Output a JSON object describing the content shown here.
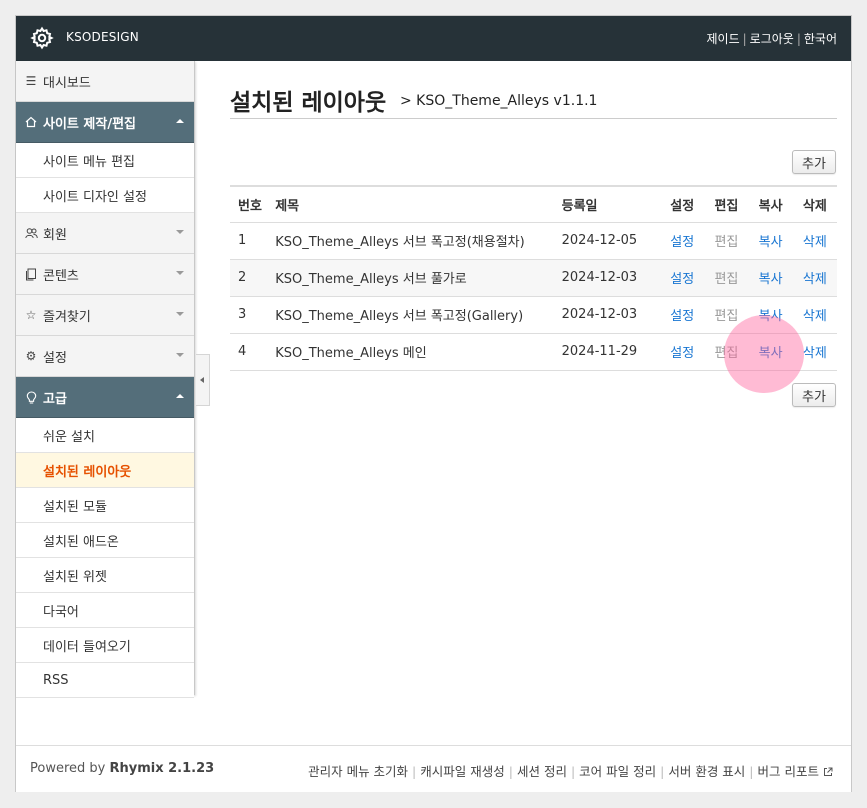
{
  "header": {
    "brand": "KSODESIGN",
    "links": [
      "제이드",
      "로그아웃",
      "한국어"
    ]
  },
  "sidebar": {
    "dashboard": "대시보드",
    "site_section": {
      "label": "사이트 제작/편집",
      "items": [
        "사이트 메뉴 편집",
        "사이트 디자인 설정"
      ]
    },
    "members": "회원",
    "contents": "콘텐츠",
    "favorites": "즐겨찾기",
    "settings": "설정",
    "advanced_section": {
      "label": "고급",
      "items": [
        "쉬운 설치",
        "설치된 레이아웃",
        "설치된 모듈",
        "설치된 애드온",
        "설치된 위젯",
        "다국어",
        "데이터 들여오기",
        "RSS"
      ],
      "active_index": 1
    }
  },
  "main": {
    "title": "설치된 레이아웃",
    "subtitle": "> KSO_Theme_Alleys v1.1.1",
    "add_button": "추가",
    "table": {
      "headers": [
        "번호",
        "제목",
        "등록일",
        "설정",
        "편집",
        "복사",
        "삭제"
      ],
      "rows": [
        {
          "no": "1",
          "title": "KSO_Theme_Alleys 서브 폭고정(채용절차)",
          "date": "2024-12-05",
          "settings": "설정",
          "edit": "편집",
          "copy": "복사",
          "delete": "삭제"
        },
        {
          "no": "2",
          "title": "KSO_Theme_Alleys 서브 풀가로",
          "date": "2024-12-03",
          "settings": "설정",
          "edit": "편집",
          "copy": "복사",
          "delete": "삭제"
        },
        {
          "no": "3",
          "title": "KSO_Theme_Alleys 서브 폭고정(Gallery)",
          "date": "2024-12-03",
          "settings": "설정",
          "edit": "편집",
          "copy": "복사",
          "delete": "삭제"
        },
        {
          "no": "4",
          "title": "KSO_Theme_Alleys 메인",
          "date": "2024-11-29",
          "settings": "설정",
          "edit": "편집",
          "copy": "복사",
          "delete": "삭제"
        }
      ]
    }
  },
  "footer": {
    "powered_prefix": "Powered by ",
    "powered_name": "Rhymix 2.1.23",
    "links": [
      "관리자 메뉴 초기화",
      "캐시파일 재생성",
      "세션 정리",
      "코어 파일 정리",
      "서버 환경 표시",
      "버그 리포트"
    ]
  },
  "colors": {
    "topbar": "#263238",
    "sidebar_head": "#546e7a",
    "active_item": "#e65100",
    "link": "#1976d2",
    "highlight": "#ff69a0"
  }
}
